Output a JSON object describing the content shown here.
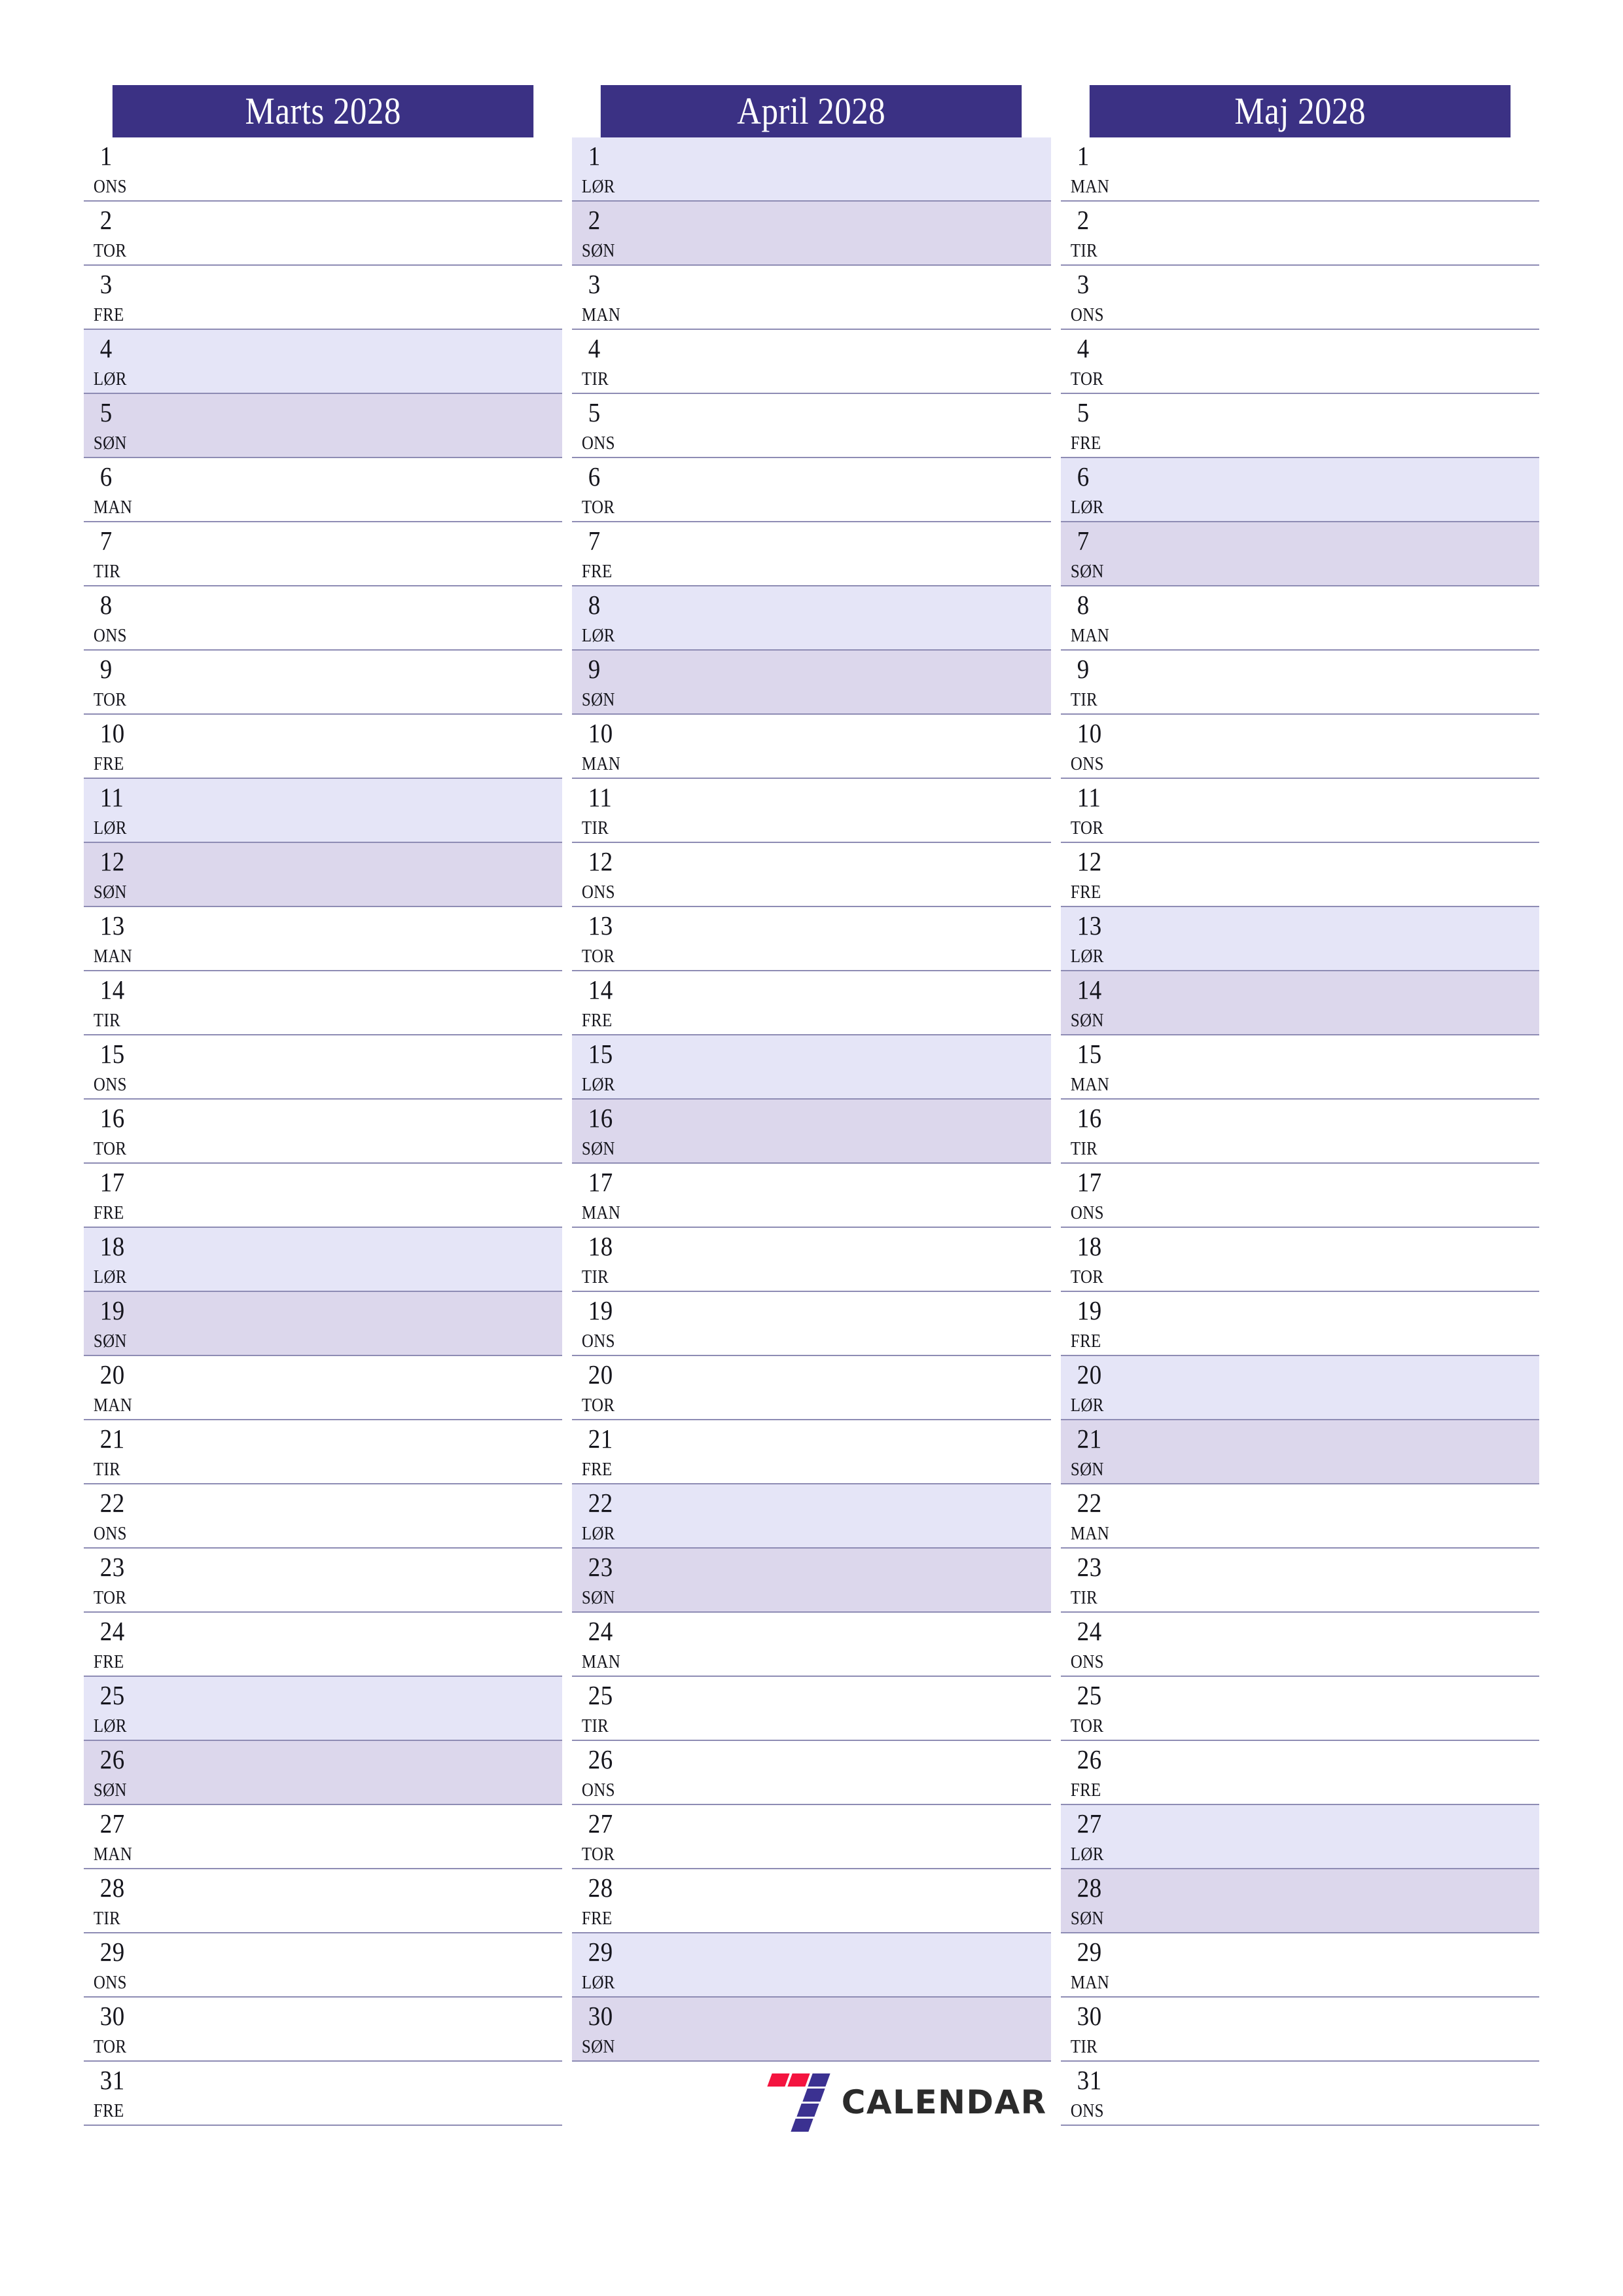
{
  "page": {
    "title": "Marts April Maj 2028 planner",
    "language": "da",
    "colors": {
      "header_bg": "#3b3184",
      "header_text": "#ffffff",
      "saturday_bg": "#e5e5f7",
      "sunday_bg": "#dcd7ec",
      "row_divider": "#8e8cb4",
      "day_text": "#15151c",
      "logo_purple": "#3b3191",
      "logo_red": "#f4143f",
      "logo_text": "#2b2b2b",
      "page_bg": "#ffffff"
    }
  },
  "brand": {
    "name": "CALENDAR",
    "mark_icon": "seven-logo-icon"
  },
  "months": [
    {
      "title": "Marts 2028",
      "name": "Marts",
      "year": "2028",
      "days": [
        {
          "num": "1",
          "abbr": "ONS",
          "type": "weekday"
        },
        {
          "num": "2",
          "abbr": "TOR",
          "type": "weekday"
        },
        {
          "num": "3",
          "abbr": "FRE",
          "type": "weekday"
        },
        {
          "num": "4",
          "abbr": "LØR",
          "type": "saturday"
        },
        {
          "num": "5",
          "abbr": "SØN",
          "type": "sunday"
        },
        {
          "num": "6",
          "abbr": "MAN",
          "type": "weekday"
        },
        {
          "num": "7",
          "abbr": "TIR",
          "type": "weekday"
        },
        {
          "num": "8",
          "abbr": "ONS",
          "type": "weekday"
        },
        {
          "num": "9",
          "abbr": "TOR",
          "type": "weekday"
        },
        {
          "num": "10",
          "abbr": "FRE",
          "type": "weekday"
        },
        {
          "num": "11",
          "abbr": "LØR",
          "type": "saturday"
        },
        {
          "num": "12",
          "abbr": "SØN",
          "type": "sunday"
        },
        {
          "num": "13",
          "abbr": "MAN",
          "type": "weekday"
        },
        {
          "num": "14",
          "abbr": "TIR",
          "type": "weekday"
        },
        {
          "num": "15",
          "abbr": "ONS",
          "type": "weekday"
        },
        {
          "num": "16",
          "abbr": "TOR",
          "type": "weekday"
        },
        {
          "num": "17",
          "abbr": "FRE",
          "type": "weekday"
        },
        {
          "num": "18",
          "abbr": "LØR",
          "type": "saturday"
        },
        {
          "num": "19",
          "abbr": "SØN",
          "type": "sunday"
        },
        {
          "num": "20",
          "abbr": "MAN",
          "type": "weekday"
        },
        {
          "num": "21",
          "abbr": "TIR",
          "type": "weekday"
        },
        {
          "num": "22",
          "abbr": "ONS",
          "type": "weekday"
        },
        {
          "num": "23",
          "abbr": "TOR",
          "type": "weekday"
        },
        {
          "num": "24",
          "abbr": "FRE",
          "type": "weekday"
        },
        {
          "num": "25",
          "abbr": "LØR",
          "type": "saturday"
        },
        {
          "num": "26",
          "abbr": "SØN",
          "type": "sunday"
        },
        {
          "num": "27",
          "abbr": "MAN",
          "type": "weekday"
        },
        {
          "num": "28",
          "abbr": "TIR",
          "type": "weekday"
        },
        {
          "num": "29",
          "abbr": "ONS",
          "type": "weekday"
        },
        {
          "num": "30",
          "abbr": "TOR",
          "type": "weekday"
        },
        {
          "num": "31",
          "abbr": "FRE",
          "type": "weekday"
        }
      ]
    },
    {
      "title": "April 2028",
      "name": "April",
      "year": "2028",
      "days": [
        {
          "num": "1",
          "abbr": "LØR",
          "type": "saturday"
        },
        {
          "num": "2",
          "abbr": "SØN",
          "type": "sunday"
        },
        {
          "num": "3",
          "abbr": "MAN",
          "type": "weekday"
        },
        {
          "num": "4",
          "abbr": "TIR",
          "type": "weekday"
        },
        {
          "num": "5",
          "abbr": "ONS",
          "type": "weekday"
        },
        {
          "num": "6",
          "abbr": "TOR",
          "type": "weekday"
        },
        {
          "num": "7",
          "abbr": "FRE",
          "type": "weekday"
        },
        {
          "num": "8",
          "abbr": "LØR",
          "type": "saturday"
        },
        {
          "num": "9",
          "abbr": "SØN",
          "type": "sunday"
        },
        {
          "num": "10",
          "abbr": "MAN",
          "type": "weekday"
        },
        {
          "num": "11",
          "abbr": "TIR",
          "type": "weekday"
        },
        {
          "num": "12",
          "abbr": "ONS",
          "type": "weekday"
        },
        {
          "num": "13",
          "abbr": "TOR",
          "type": "weekday"
        },
        {
          "num": "14",
          "abbr": "FRE",
          "type": "weekday"
        },
        {
          "num": "15",
          "abbr": "LØR",
          "type": "saturday"
        },
        {
          "num": "16",
          "abbr": "SØN",
          "type": "sunday"
        },
        {
          "num": "17",
          "abbr": "MAN",
          "type": "weekday"
        },
        {
          "num": "18",
          "abbr": "TIR",
          "type": "weekday"
        },
        {
          "num": "19",
          "abbr": "ONS",
          "type": "weekday"
        },
        {
          "num": "20",
          "abbr": "TOR",
          "type": "weekday"
        },
        {
          "num": "21",
          "abbr": "FRE",
          "type": "weekday"
        },
        {
          "num": "22",
          "abbr": "LØR",
          "type": "saturday"
        },
        {
          "num": "23",
          "abbr": "SØN",
          "type": "sunday"
        },
        {
          "num": "24",
          "abbr": "MAN",
          "type": "weekday"
        },
        {
          "num": "25",
          "abbr": "TIR",
          "type": "weekday"
        },
        {
          "num": "26",
          "abbr": "ONS",
          "type": "weekday"
        },
        {
          "num": "27",
          "abbr": "TOR",
          "type": "weekday"
        },
        {
          "num": "28",
          "abbr": "FRE",
          "type": "weekday"
        },
        {
          "num": "29",
          "abbr": "LØR",
          "type": "saturday"
        },
        {
          "num": "30",
          "abbr": "SØN",
          "type": "sunday"
        }
      ]
    },
    {
      "title": "Maj 2028",
      "name": "Maj",
      "year": "2028",
      "days": [
        {
          "num": "1",
          "abbr": "MAN",
          "type": "weekday"
        },
        {
          "num": "2",
          "abbr": "TIR",
          "type": "weekday"
        },
        {
          "num": "3",
          "abbr": "ONS",
          "type": "weekday"
        },
        {
          "num": "4",
          "abbr": "TOR",
          "type": "weekday"
        },
        {
          "num": "5",
          "abbr": "FRE",
          "type": "weekday"
        },
        {
          "num": "6",
          "abbr": "LØR",
          "type": "saturday"
        },
        {
          "num": "7",
          "abbr": "SØN",
          "type": "sunday"
        },
        {
          "num": "8",
          "abbr": "MAN",
          "type": "weekday"
        },
        {
          "num": "9",
          "abbr": "TIR",
          "type": "weekday"
        },
        {
          "num": "10",
          "abbr": "ONS",
          "type": "weekday"
        },
        {
          "num": "11",
          "abbr": "TOR",
          "type": "weekday"
        },
        {
          "num": "12",
          "abbr": "FRE",
          "type": "weekday"
        },
        {
          "num": "13",
          "abbr": "LØR",
          "type": "saturday"
        },
        {
          "num": "14",
          "abbr": "SØN",
          "type": "sunday"
        },
        {
          "num": "15",
          "abbr": "MAN",
          "type": "weekday"
        },
        {
          "num": "16",
          "abbr": "TIR",
          "type": "weekday"
        },
        {
          "num": "17",
          "abbr": "ONS",
          "type": "weekday"
        },
        {
          "num": "18",
          "abbr": "TOR",
          "type": "weekday"
        },
        {
          "num": "19",
          "abbr": "FRE",
          "type": "weekday"
        },
        {
          "num": "20",
          "abbr": "LØR",
          "type": "saturday"
        },
        {
          "num": "21",
          "abbr": "SØN",
          "type": "sunday"
        },
        {
          "num": "22",
          "abbr": "MAN",
          "type": "weekday"
        },
        {
          "num": "23",
          "abbr": "TIR",
          "type": "weekday"
        },
        {
          "num": "24",
          "abbr": "ONS",
          "type": "weekday"
        },
        {
          "num": "25",
          "abbr": "TOR",
          "type": "weekday"
        },
        {
          "num": "26",
          "abbr": "FRE",
          "type": "weekday"
        },
        {
          "num": "27",
          "abbr": "LØR",
          "type": "saturday"
        },
        {
          "num": "28",
          "abbr": "SØN",
          "type": "sunday"
        },
        {
          "num": "29",
          "abbr": "MAN",
          "type": "weekday"
        },
        {
          "num": "30",
          "abbr": "TIR",
          "type": "weekday"
        },
        {
          "num": "31",
          "abbr": "ONS",
          "type": "weekday"
        }
      ]
    }
  ]
}
